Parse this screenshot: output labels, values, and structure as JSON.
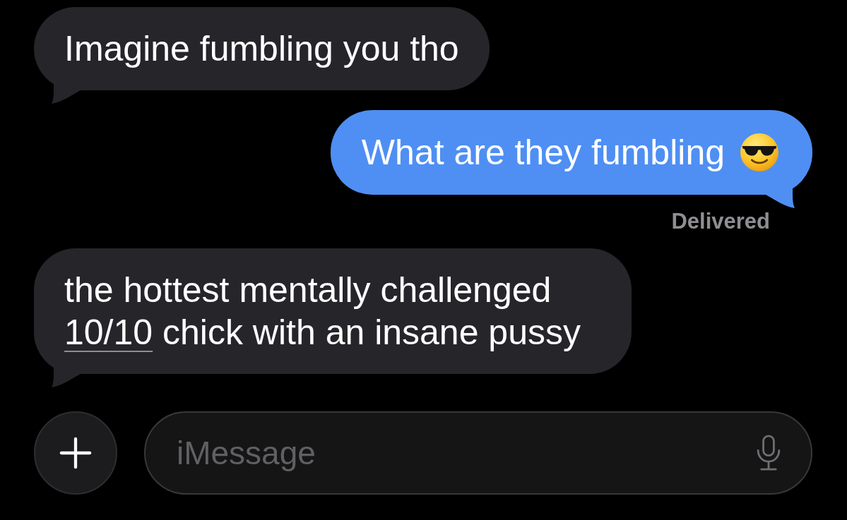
{
  "messages": [
    {
      "kind": "received",
      "parts": [
        {
          "kind": "text",
          "text": "Imagine fumbling you tho"
        }
      ]
    },
    {
      "kind": "sent",
      "parts": [
        {
          "kind": "text",
          "text": "What are they fumbling"
        },
        {
          "kind": "emoji"
        }
      ],
      "status": "Delivered"
    },
    {
      "kind": "received",
      "parts": [
        {
          "kind": "text",
          "text": "the hottest mentally challenged "
        },
        {
          "kind": "link",
          "text": "10/10"
        },
        {
          "kind": "text",
          "text": " chick with an insane pussy"
        }
      ]
    }
  ],
  "composer": {
    "placeholder": "iMessage"
  }
}
